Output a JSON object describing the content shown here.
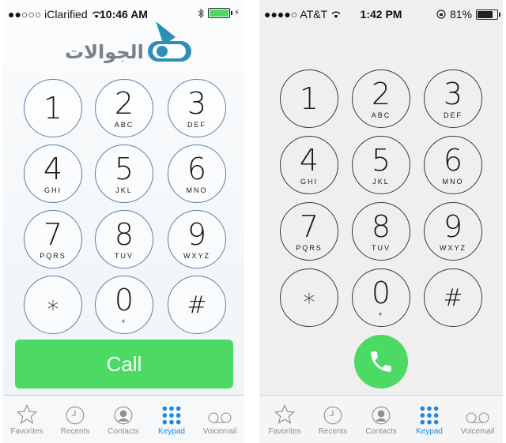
{
  "left_phone": {
    "status": {
      "carrier": "●●○○○ iClarified",
      "time": "10:46 AM"
    },
    "logo_text": "الجوالات",
    "keypad": [
      {
        "digit": "1",
        "letters": ""
      },
      {
        "digit": "2",
        "letters": "ABC"
      },
      {
        "digit": "3",
        "letters": "DEF"
      },
      {
        "digit": "4",
        "letters": "GHI"
      },
      {
        "digit": "5",
        "letters": "JKL"
      },
      {
        "digit": "6",
        "letters": "MNO"
      },
      {
        "digit": "7",
        "letters": "PQRS"
      },
      {
        "digit": "8",
        "letters": "TUV"
      },
      {
        "digit": "9",
        "letters": "WXYZ"
      },
      {
        "digit": "∗",
        "letters": ""
      },
      {
        "digit": "0",
        "letters": "+"
      },
      {
        "digit": "#",
        "letters": ""
      }
    ],
    "call_label": "Call",
    "tabs": [
      "Favorites",
      "Recents",
      "Contacts",
      "Keypad",
      "Voicemail"
    ],
    "active_tab": "Keypad"
  },
  "right_phone": {
    "status": {
      "carrier": "●●●●○ AT&T",
      "time": "1:42 PM",
      "battery": "81%"
    },
    "keypad": [
      {
        "digit": "1",
        "letters": ""
      },
      {
        "digit": "2",
        "letters": "ABC"
      },
      {
        "digit": "3",
        "letters": "DEF"
      },
      {
        "digit": "4",
        "letters": "GHI"
      },
      {
        "digit": "5",
        "letters": "JKL"
      },
      {
        "digit": "6",
        "letters": "MNO"
      },
      {
        "digit": "7",
        "letters": "PQRS"
      },
      {
        "digit": "8",
        "letters": "TUV"
      },
      {
        "digit": "9",
        "letters": "WXYZ"
      },
      {
        "digit": "∗",
        "letters": ""
      },
      {
        "digit": "0",
        "letters": "+"
      },
      {
        "digit": "#",
        "letters": ""
      }
    ],
    "tabs": [
      "Favorites",
      "Recents",
      "Contacts",
      "Keypad",
      "Voicemail"
    ],
    "active_tab": "Keypad"
  },
  "colors": {
    "call_green": "#4cd964",
    "active_blue": "#1e88e5",
    "inactive_gray": "#8e8e93"
  }
}
